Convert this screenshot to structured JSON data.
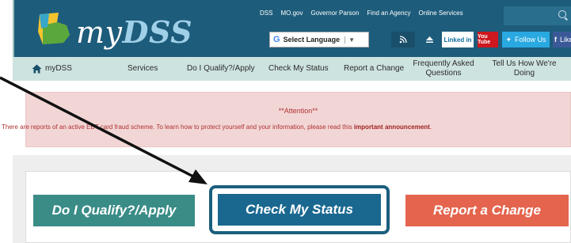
{
  "header": {
    "logo": {
      "prefix": "my",
      "name": "DSS"
    },
    "top_links": [
      "DSS",
      "MO.gov",
      "Governor Parson",
      "Find an Agency",
      "Online Services"
    ],
    "search_placeholder": "",
    "language": {
      "label": "Select Language",
      "arrow": "▼"
    },
    "social": {
      "linkedin": "Linked in",
      "youtube": "You Tube",
      "twitter": "Follow Us",
      "facebook": "Like Us"
    }
  },
  "nav": {
    "items": [
      "myDSS",
      "Services",
      "Do I Qualify?/Apply",
      "Check My Status",
      "Report a Change",
      "Frequently Asked Questions",
      "Tell Us How We're Doing"
    ]
  },
  "attention": {
    "title": "**Attention**",
    "body_prefix": "There are reports of an active EBT card fraud scheme. To learn how to protect yourself and your information, please read this ",
    "body_link": "important announcement",
    "body_suffix": "."
  },
  "buttons": {
    "qualify": "Do I Qualify?/Apply",
    "status": "Check My Status",
    "change": "Report a Change"
  },
  "colors": {
    "header_bg": "#1d5c7b",
    "nav_bg": "#cde3e0",
    "attention_bg": "#f2d6d6",
    "qualify_btn": "#3a8c87",
    "status_btn": "#1a6890",
    "change_btn": "#e4644d"
  },
  "icons": {
    "home": "home-icon",
    "search": "search-icon",
    "rss": "rss-icon",
    "arrow": "pointer-arrow-icon"
  }
}
